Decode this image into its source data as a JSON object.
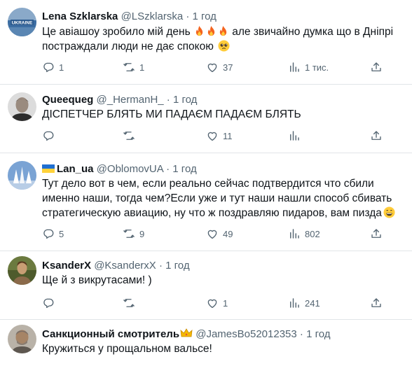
{
  "tweets": [
    {
      "name": "Lena Szklarska",
      "handle": "@LSzklarska",
      "dot": "·",
      "time": "1 год",
      "text_a": "Це авіашоу зробило мій день ",
      "text_b": " але звичайно думка що в Дніпрі постраждали люди не дає спокою ",
      "replies": "1",
      "retweets": "1",
      "likes": "37",
      "views": "1 тис."
    },
    {
      "name": "Queequeg",
      "handle": "@_HermanH_",
      "dot": "·",
      "time": "1 год",
      "text": "ДІСПЕТЧЕР БЛЯТЬ МИ ПАДАЄМ ПАДАЄМ БЛЯТЬ",
      "replies": "",
      "retweets": "",
      "likes": "11",
      "views": ""
    },
    {
      "name": "Lan_ua",
      "handle": "@OblomovUA",
      "dot": "·",
      "time": "1 год",
      "text": "Тут дело вот в чем, если реально сейчас подтвердится что сбили именно наши, тогда чем?Если уже и тут наши нашли способ сбивать стратегическую авиацию, ну что ж поздравляю пидаров, вам пизда",
      "replies": "5",
      "retweets": "9",
      "likes": "49",
      "views": "802"
    },
    {
      "name": "KsanderX",
      "handle": "@KsanderxX",
      "dot": "·",
      "time": "1 год",
      "text": "Ще й з викрутасами! )",
      "replies": "",
      "retweets": "",
      "likes": "1",
      "views": "241"
    },
    {
      "name": "Санкционный смотритель",
      "handle": "@JamesBo52012353",
      "dot": "·",
      "time": "1 год",
      "text": "Кружиться у прощальном вальсе!"
    }
  ],
  "colors": {
    "text": "#0f1419",
    "muted": "#536471",
    "divider": "#e1e5e8"
  },
  "avatar_labels": {
    "t1": "UKRAINE"
  }
}
